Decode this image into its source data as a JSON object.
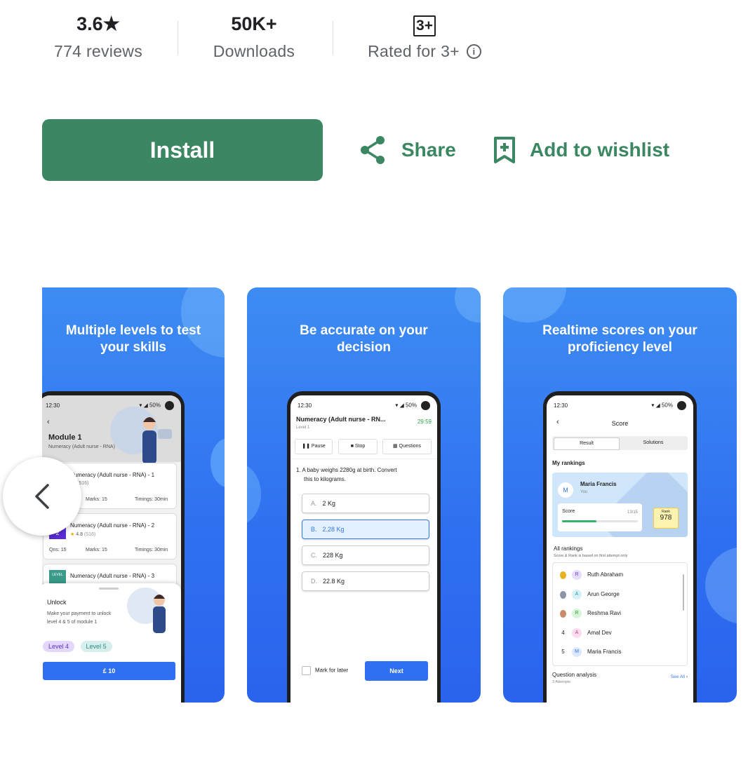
{
  "stats": {
    "rating_value": "3.6★",
    "rating_label": "774 reviews",
    "downloads_value": "50K+",
    "downloads_label": "Downloads",
    "content_rating_badge": "3+",
    "content_rating_label": "Rated for 3+"
  },
  "actions": {
    "install_label": "Install",
    "share_label": "Share",
    "wishlist_label": "Add to wishlist"
  },
  "colors": {
    "accent": "#3a8762",
    "screenshot_bg": "#2f6ff0"
  },
  "screenshots": [
    {
      "heading_line1": "Multiple levels to test",
      "heading_line2": "your skills",
      "time": "12:30",
      "battery": "50%",
      "module_title": "Module 1",
      "module_subtitle": "Numeracy (Adult nurse - RNA)",
      "item1_title": "Numeracy (Adult nurse - RNA) - 1",
      "item1_rating": "(516)",
      "item1_marks": "Marks: 15",
      "item1_timing": "Timings: 30min",
      "item2_title": "Numeracy (Adult nurse - RNA) - 2",
      "item2_badge": "2",
      "item2_rating": "4.8",
      "item2_rating_count": "(516)",
      "item2_qns": "Qns: 15",
      "item2_marks": "Marks: 15",
      "item2_timing": "Timings: 30min",
      "item3_level": "LEVEL",
      "item3_title": "Numeracy (Adult nurse - RNA) - 3",
      "unlock_title": "Unlock",
      "unlock_desc_1": "Make your payment to unlock",
      "unlock_desc_2": "level 4 & 5 of module 1",
      "chip1": "Level 4",
      "chip2": "Level 5",
      "pay_label": "£ 10"
    },
    {
      "heading_line1": "Be accurate on your",
      "heading_line2": "decision",
      "time": "12:30",
      "battery": "50%",
      "quiz_title": "Numeracy (Adult nurse - RN...",
      "quiz_level": "Level 1",
      "timer": "29:59",
      "pause_label": "Pause",
      "stop_label": "Stop",
      "questions_label": "Questions",
      "question_number": "1.",
      "question_line1": "A baby weighs 2280g at birth. Convert",
      "question_line2": "this to kilograms.",
      "options": [
        {
          "letter": "A.",
          "text": "2 Kg"
        },
        {
          "letter": "B.",
          "text": "2.28 Kg"
        },
        {
          "letter": "C.",
          "text": "228 Kg"
        },
        {
          "letter": "D.",
          "text": "22.8 Kg"
        }
      ],
      "mark_later_label": "Mark for later",
      "next_label": "Next"
    },
    {
      "heading_line1": "Realtime scores on your",
      "heading_line2": "proficiency level",
      "time": "12:30",
      "battery": "50%",
      "screen_title": "Score",
      "tab_result": "Result",
      "tab_solutions": "Solutions",
      "my_rankings": "My rankings",
      "user_initial": "M",
      "user_name": "Maria Francis",
      "user_sub": "You",
      "score_label": "Score",
      "score_value": "13/15",
      "rank_label": "Rank",
      "rank_value": "978",
      "all_rankings": "All rankings",
      "all_rankings_note": "Score & Rank is based on first attempt only",
      "rankings": [
        {
          "pos": "",
          "initial": "R",
          "name": "Ruth Abraham"
        },
        {
          "pos": "",
          "initial": "A",
          "name": "Arun George"
        },
        {
          "pos": "",
          "initial": "R",
          "name": "Reshma Ravi"
        },
        {
          "pos": "4",
          "initial": "A",
          "name": "Amal Dev"
        },
        {
          "pos": "5",
          "initial": "M",
          "name": "Maria Francis"
        }
      ],
      "question_analysis": "Question analysis",
      "attempts": "3 Attempts",
      "see_all": "See All"
    }
  ]
}
